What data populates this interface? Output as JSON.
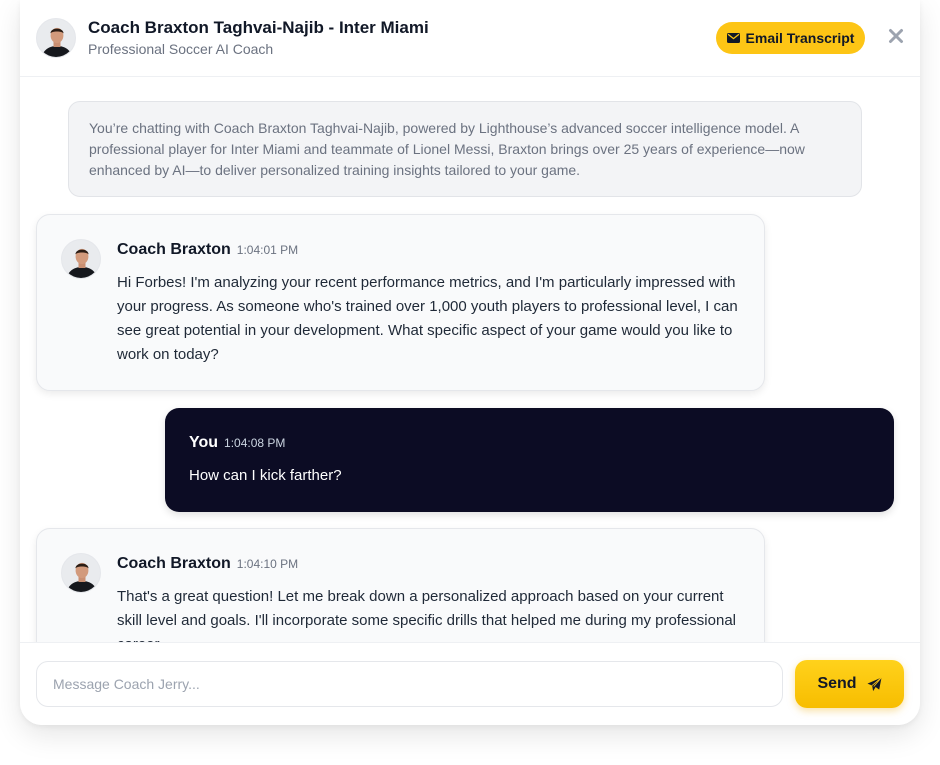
{
  "header": {
    "coach_name": "Coach Braxton Taghvai-Najib - Inter Miami",
    "subtitle": "Professional Soccer AI Coach",
    "avatar_icon": "coach-avatar",
    "email_button_label": "Email Transcript",
    "email_icon": "envelope-icon",
    "close_icon": "close-icon"
  },
  "intro": {
    "text": "You’re chatting with Coach Braxton Taghvai-Najib, powered by Lighthouse’s advanced soccer intelligence model. A professional player for Inter Miami and teammate of Lionel Messi, Braxton brings over 25 years of experience—now enhanced by AI—to deliver personalized training insights tailored to your game."
  },
  "messages": [
    {
      "author": "Coach Braxton",
      "time": "1:04:01 PM",
      "text": "Hi Forbes! I'm analyzing your recent performance metrics, and I'm particularly impressed with your progress. As someone who's trained over 1,000 youth players to professional level, I can see great potential in your development. What specific aspect of your game would you like to work on today?"
    },
    {
      "author": "You",
      "time": "1:04:08 PM",
      "text": "How can I kick farther?"
    },
    {
      "author": "Coach Braxton",
      "time": "1:04:10 PM",
      "text": "That's a great question! Let me break down a personalized approach based on your current skill level and goals. I'll incorporate some specific drills that helped me during my professional career."
    }
  ],
  "composer": {
    "placeholder": "Message Coach Jerry...",
    "value": "",
    "send_label": "Send",
    "send_icon": "paper-plane-icon"
  },
  "colors": {
    "accent": "#fdc515",
    "user_bubble": "#0c0c24",
    "coach_bubble": "#f9fafb",
    "intro_bg": "#f3f4f6"
  }
}
